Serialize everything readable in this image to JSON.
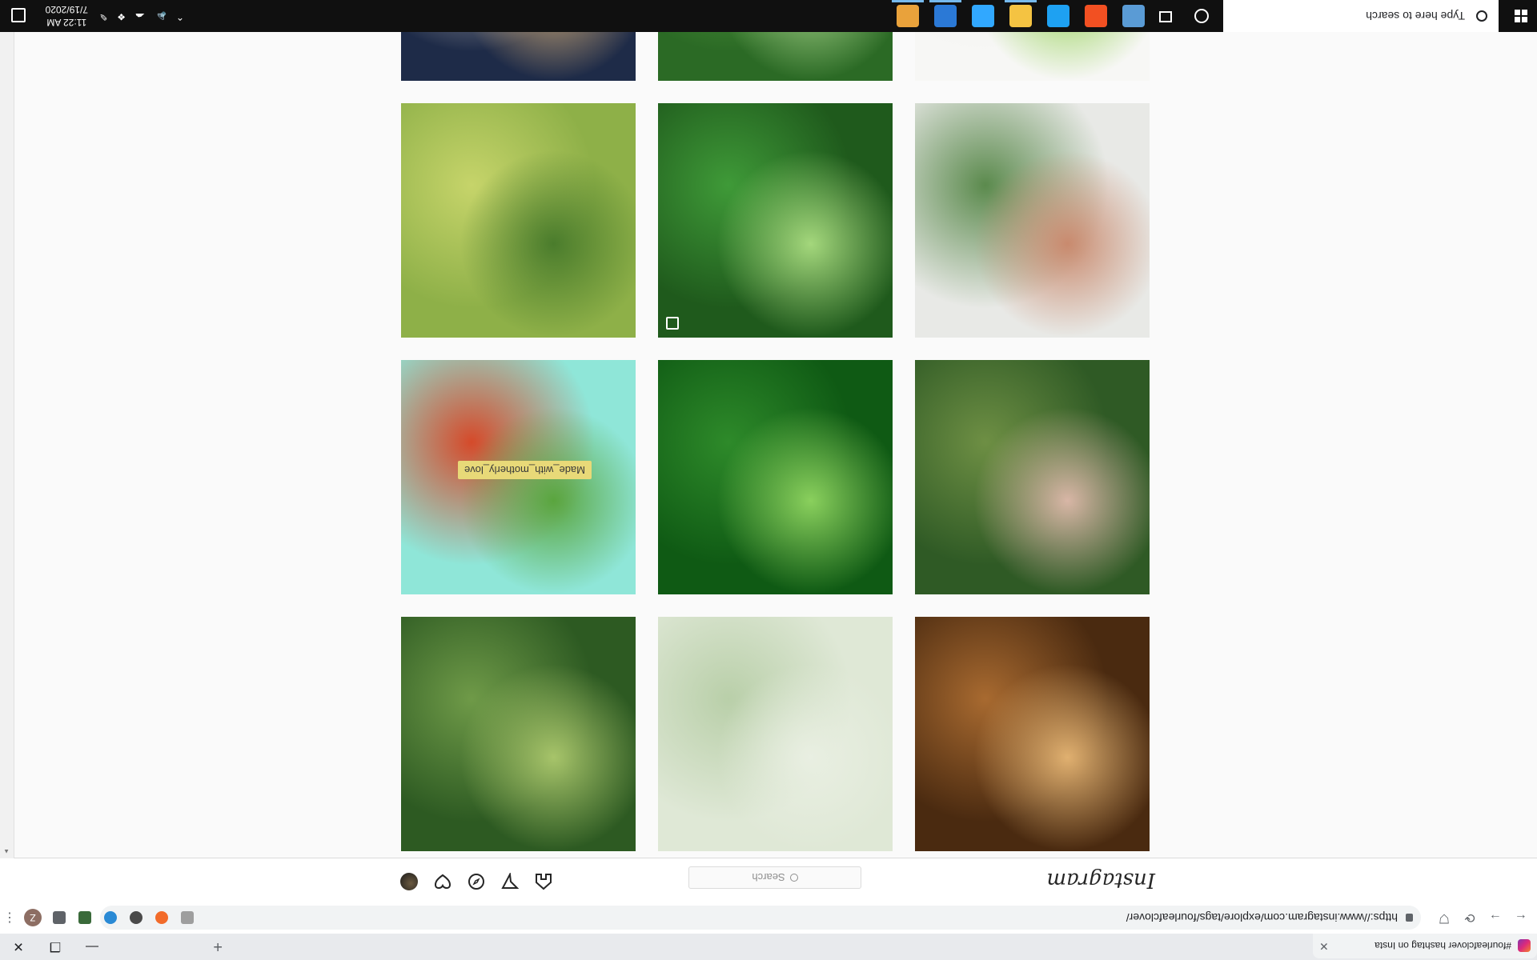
{
  "browser": {
    "tab_title": "#fourleafclover hashtag on Insta",
    "url": "https://www.instagram.com/explore/tags/fourleafclover/",
    "profile_initial": "Z",
    "new_tab_icon": "plus-icon",
    "min_icon": "minimize-icon",
    "restore_icon": "restore-icon",
    "close_icon": "close-icon"
  },
  "instagram": {
    "logo": "Instagram",
    "search_placeholder": "Search",
    "nav_icons": [
      "home-icon",
      "direct-icon",
      "explore-icon",
      "activity-icon",
      "profile-avatar"
    ]
  },
  "grid": {
    "tiles": [
      {
        "alt": "dog",
        "colors": [
          "#4a2a10",
          "#a86a30",
          "#e0b070"
        ]
      },
      {
        "alt": "clover-pale",
        "colors": [
          "#dfe8d6",
          "#b9cfa9",
          "#e9efe2"
        ]
      },
      {
        "alt": "clover-plants",
        "colors": [
          "#2d5a22",
          "#6f9a48",
          "#a7c46a"
        ]
      },
      {
        "alt": "hand-picking-clover",
        "colors": [
          "#2f5a25",
          "#6e8f44",
          "#d8b6a6"
        ]
      },
      {
        "alt": "green-pattern",
        "colors": [
          "#0f5a14",
          "#2e8a2a",
          "#8ad05d"
        ]
      },
      {
        "alt": "made-with-motherly-love",
        "colors": [
          "#8fe6d8",
          "#d54a2a",
          "#5aa53e"
        ],
        "caption": "Made_with_motherly_love"
      },
      {
        "alt": "pressed-clovers-cards",
        "colors": [
          "#e8e9e6",
          "#5b8a4d",
          "#c98a6e"
        ]
      },
      {
        "alt": "ladybug-on-grass",
        "colors": [
          "#1f5a1c",
          "#3f9a38",
          "#a4d77c"
        ]
      },
      {
        "alt": "hand-holding-four-leaf-clover",
        "colors": [
          "#8eb048",
          "#c6d46a",
          "#4a7c2c"
        ]
      },
      {
        "alt": "origami-clover",
        "colors": [
          "#f7f7f5",
          "#ececea",
          "#8fce4d"
        ]
      },
      {
        "alt": "clover-field",
        "colors": [
          "#2b6a25",
          "#5fa747",
          "#a9d68c"
        ]
      },
      {
        "alt": "girl-with-clover",
        "colors": [
          "#1e2b48",
          "#e9dfd2",
          "#d7b17a"
        ]
      },
      {
        "alt": "peek-left",
        "colors": [
          "#c76b2a",
          "#e3a060",
          "#f0c590"
        ]
      },
      {
        "alt": "peek-mid",
        "colors": [
          "#1f4a18",
          "#3a6a2a",
          "#5a8a3a"
        ]
      },
      {
        "alt": "peek-right",
        "colors": [
          "#c89a7a",
          "#e0b896",
          "#8a5a3a"
        ]
      }
    ]
  },
  "taskbar": {
    "search_text": "Type here to search",
    "time": "11:22 AM",
    "date": "7/19/2020",
    "apps": [
      {
        "name": "chrome-icon",
        "color": "#e9a23b"
      },
      {
        "name": "onedrive-photos-icon",
        "color": "#2b79d6"
      },
      {
        "name": "photoshop-icon",
        "color": "#31a8ff"
      },
      {
        "name": "file-explorer-icon",
        "color": "#f4c342"
      },
      {
        "name": "edge-icon",
        "color": "#1ea1f2"
      },
      {
        "name": "store-icon",
        "color": "#f25022"
      },
      {
        "name": "settings-icon",
        "color": "#5a9bd5"
      }
    ]
  }
}
